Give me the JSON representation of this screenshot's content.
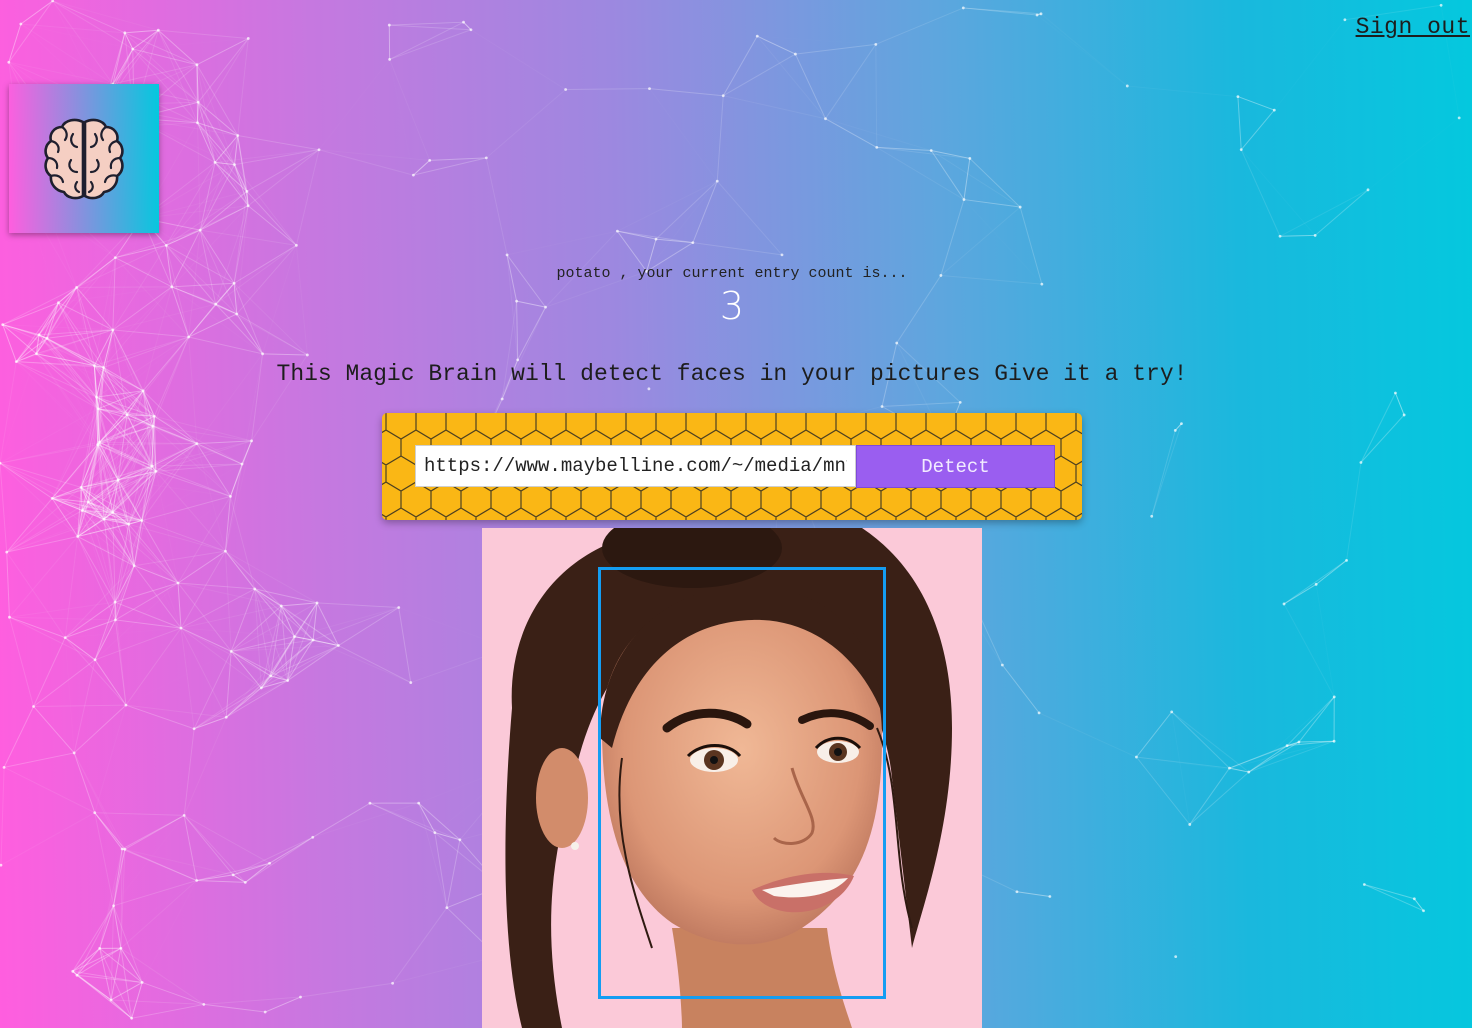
{
  "nav": {
    "signout_label": "Sign out"
  },
  "logo": {
    "icon": "brain-icon"
  },
  "rank": {
    "user_name": "potato",
    "label_suffix": " , your current entry count is...",
    "entry_count": "3"
  },
  "tagline": "This Magic Brain will detect faces in your pictures Give it a try!",
  "form": {
    "url_value": "https://www.maybelline.com/~/media/mny/global/face-makeup",
    "button_label": "Detect"
  },
  "colors": {
    "gradient_left": "#ff5edf",
    "gradient_right": "#04c8de",
    "form_bg": "#fab715",
    "button_bg": "#9a5ef0",
    "face_box": "#149df2"
  }
}
